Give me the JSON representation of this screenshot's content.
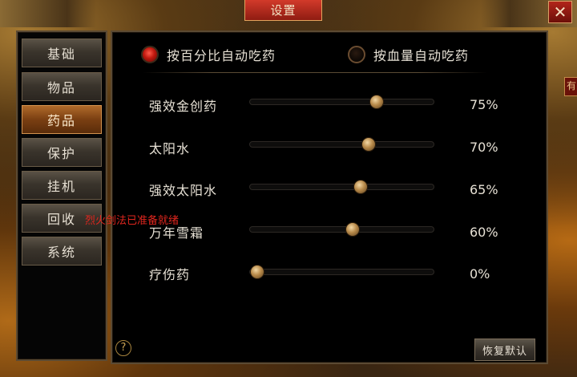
{
  "window": {
    "title": "设置",
    "close_icon": "close-icon",
    "edge_tab_label": "有"
  },
  "sidebar": {
    "items": [
      {
        "label": "基础",
        "active": false
      },
      {
        "label": "物品",
        "active": false
      },
      {
        "label": "药品",
        "active": true
      },
      {
        "label": "保护",
        "active": false
      },
      {
        "label": "挂机",
        "active": false
      },
      {
        "label": "回收",
        "active": false
      },
      {
        "label": "系统",
        "active": false
      }
    ]
  },
  "notice": {
    "text": "烈火剑法已准备就绪",
    "color": "#e0261e"
  },
  "mode": {
    "option_percent": {
      "label": "按百分比自动吃药",
      "selected": true
    },
    "option_hp": {
      "label": "按血量自动吃药",
      "selected": false
    }
  },
  "potions": [
    {
      "name": "强效金创药",
      "value": 75,
      "display": "75%"
    },
    {
      "name": "太阳水",
      "value": 70,
      "display": "70%"
    },
    {
      "name": "强效太阳水",
      "value": 65,
      "display": "65%"
    },
    {
      "name": "万年雪霜",
      "value": 60,
      "display": "60%"
    },
    {
      "name": "疗伤药",
      "value": 0,
      "display": "0%"
    }
  ],
  "footer": {
    "help_label": "?",
    "reset_label": "恢复默认"
  }
}
